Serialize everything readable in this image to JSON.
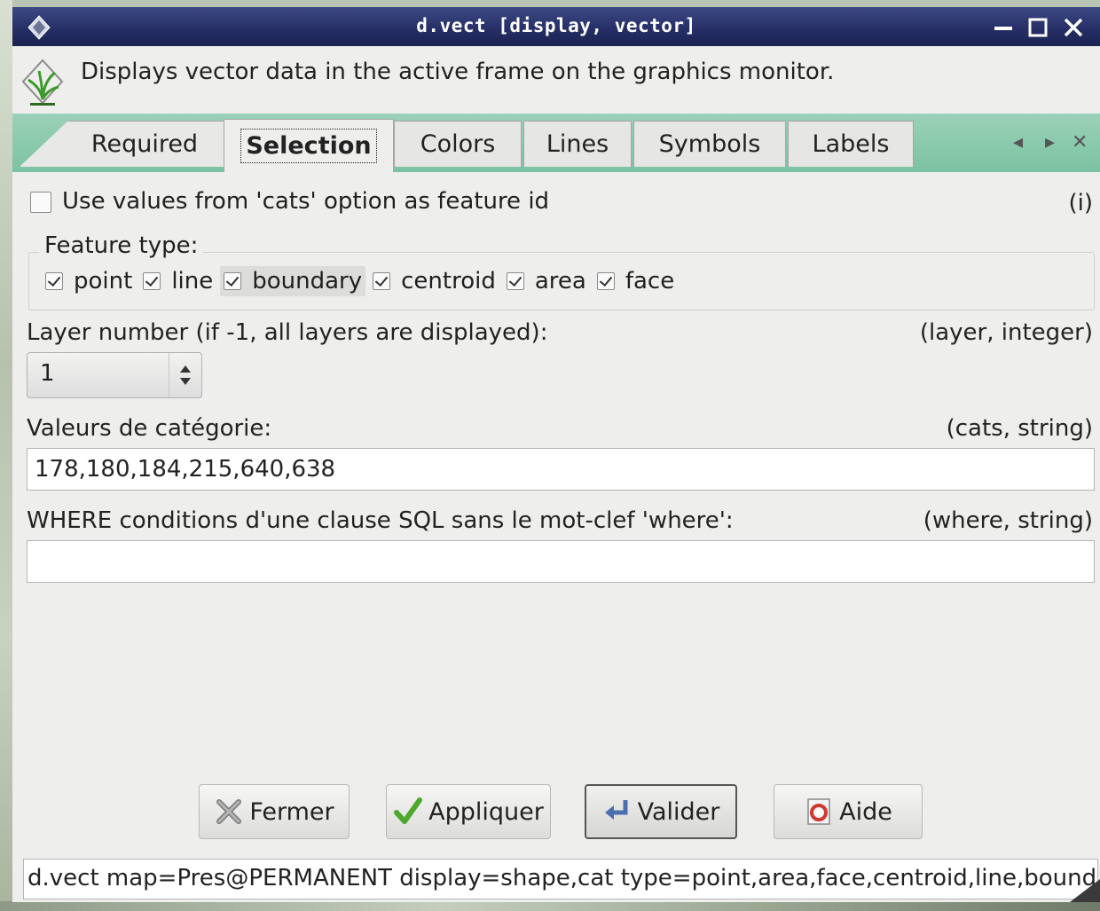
{
  "window": {
    "title": "d.vect [display, vector]",
    "description": "Displays vector data in the active frame on the graphics monitor."
  },
  "tabs": [
    {
      "label": "Required",
      "active": false
    },
    {
      "label": "Selection",
      "active": true
    },
    {
      "label": "Colors",
      "active": false
    },
    {
      "label": "Lines",
      "active": false
    },
    {
      "label": "Symbols",
      "active": false
    },
    {
      "label": "Labels",
      "active": false
    }
  ],
  "tab_scroll": {
    "left": "◂",
    "right": "▸",
    "close": "✕"
  },
  "selection": {
    "use_cats_label": "Use values from 'cats' option as feature id",
    "use_cats_checked": false,
    "info_tag": "(i)",
    "feature_type_legend": "Feature type:",
    "feature_types": [
      {
        "label": "point",
        "checked": true
      },
      {
        "label": "line",
        "checked": true
      },
      {
        "label": "boundary",
        "checked": true
      },
      {
        "label": "centroid",
        "checked": true
      },
      {
        "label": "area",
        "checked": true
      },
      {
        "label": "face",
        "checked": true
      }
    ],
    "layer_label": "Layer number (if -1, all layers are displayed):",
    "layer_tag": "(layer, integer)",
    "layer_value": "1",
    "cats_label": "Valeurs de catégorie:",
    "cats_tag": "(cats, string)",
    "cats_value": "178,180,184,215,640,638",
    "where_label": "WHERE conditions d'une clause SQL sans le mot-clef 'where':",
    "where_tag": "(where, string)",
    "where_value": ""
  },
  "buttons": {
    "close": "Fermer",
    "apply": "Appliquer",
    "run": "Valider",
    "help": "Aide"
  },
  "command_line": "d.vect map=Pres@PERMANENT display=shape,cat type=point,area,face,centroid,line,boundary",
  "colors": {
    "titlebar": "#262f66",
    "tabbar": "#7cc2a2",
    "panel": "#eeeeec"
  }
}
